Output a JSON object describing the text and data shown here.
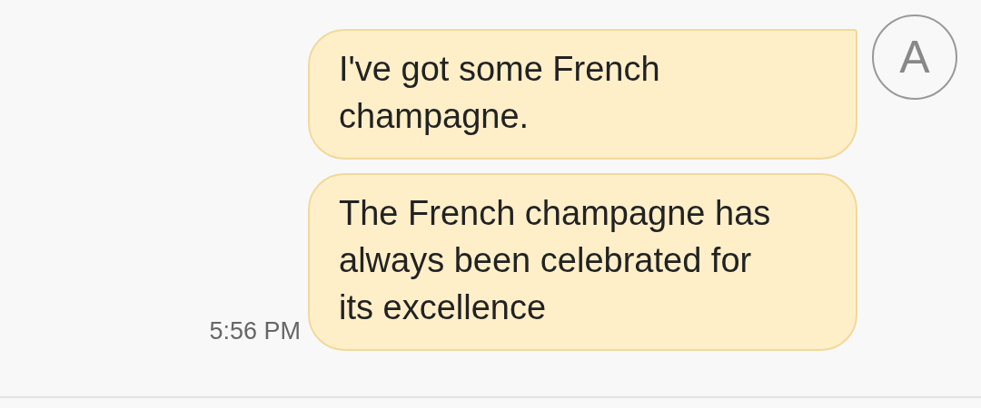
{
  "avatar": {
    "letter": "A"
  },
  "messages": [
    {
      "text": "I've got some French champagne.",
      "first": true
    },
    {
      "text": "The French champagne has always been celebrated for its excellence",
      "first": false,
      "time": "5:56 PM"
    }
  ]
}
